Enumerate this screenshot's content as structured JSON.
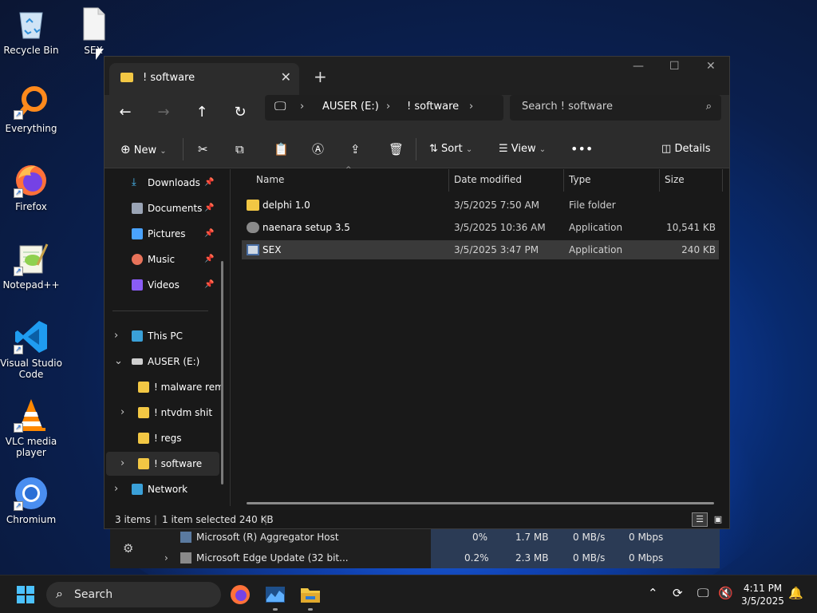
{
  "desktop": {
    "icons": [
      {
        "label": "Recycle Bin",
        "icon": "recycle-bin-icon"
      },
      {
        "label": "SEX",
        "icon": "blank-file-icon"
      },
      {
        "label": "Everything",
        "icon": "everything-search-icon"
      },
      {
        "label": "Firefox",
        "icon": "firefox-icon"
      },
      {
        "label": "Notepad++",
        "icon": "notepad-plus-plus-icon"
      },
      {
        "label": "Visual Studio Code",
        "icon": "vscode-icon"
      },
      {
        "label": "VLC media player",
        "icon": "vlc-icon"
      },
      {
        "label": "Chromium",
        "icon": "chromium-icon"
      }
    ]
  },
  "explorer": {
    "tab_title": "! software",
    "address": {
      "root_icon": "computer-icon",
      "segments": [
        "AUSER (E:)",
        "! software"
      ]
    },
    "search_placeholder": "Search ! software",
    "toolbar": {
      "new_label": "New",
      "sort_label": "Sort",
      "view_label": "View",
      "details_label": "Details"
    },
    "navpane": {
      "quick_access": [
        {
          "label": "Downloads",
          "icon": "download-icon",
          "color": "#4cc2ff"
        },
        {
          "label": "Documents",
          "icon": "documents-icon",
          "color": "#9aa4b5"
        },
        {
          "label": "Pictures",
          "icon": "pictures-icon",
          "color": "#4aa3ff"
        },
        {
          "label": "Music",
          "icon": "music-icon",
          "color": "#e8735a"
        },
        {
          "label": "Videos",
          "icon": "videos-icon",
          "color": "#8a5cf6"
        }
      ],
      "tree": [
        {
          "label": "This PC",
          "icon": "this-pc-icon",
          "chevron": "›"
        },
        {
          "label": "AUSER (E:)",
          "icon": "drive-icon",
          "chevron": "⌄"
        },
        {
          "label": "! malware rem",
          "icon": "folder-icon",
          "chevron": ""
        },
        {
          "label": "! ntvdm shit",
          "icon": "folder-icon",
          "chevron": "›"
        },
        {
          "label": "! regs",
          "icon": "folder-icon",
          "chevron": ""
        },
        {
          "label": "! software",
          "icon": "folder-icon",
          "chevron": "›"
        },
        {
          "label": "Network",
          "icon": "network-icon",
          "chevron": "›"
        }
      ]
    },
    "columns": [
      "Name",
      "Date modified",
      "Type",
      "Size"
    ],
    "files": [
      {
        "name": "delphi 1.0",
        "date": "3/5/2025 7:50 AM",
        "type": "File folder",
        "size": "",
        "icon": "folder-icon"
      },
      {
        "name": "naenara setup 3.5",
        "date": "3/5/2025 10:36 AM",
        "type": "Application",
        "size": "10,541 KB",
        "icon": "installer-icon"
      },
      {
        "name": "SEX",
        "date": "3/5/2025 3:47 PM",
        "type": "Application",
        "size": "240 KB",
        "icon": "application-icon"
      }
    ],
    "status": {
      "count": "3 items",
      "selected": "1 item selected  240 KB"
    }
  },
  "task_manager": {
    "rows": [
      {
        "name": "Microsoft (R) Aggregator Host",
        "cpu": "0%",
        "mem": "1.7 MB",
        "disk": "0 MB/s",
        "net": "0 Mbps"
      },
      {
        "name": "Microsoft Edge Update (32 bit...",
        "cpu": "0.2%",
        "mem": "2.3 MB",
        "disk": "0 MB/s",
        "net": "0 Mbps"
      }
    ]
  },
  "taskbar": {
    "search_label": "Search",
    "time": "4:11 PM",
    "date": "3/5/2025"
  },
  "colors": {
    "accent": "#0078d4",
    "folder": "#f2c744",
    "window_bg": "#191919"
  }
}
